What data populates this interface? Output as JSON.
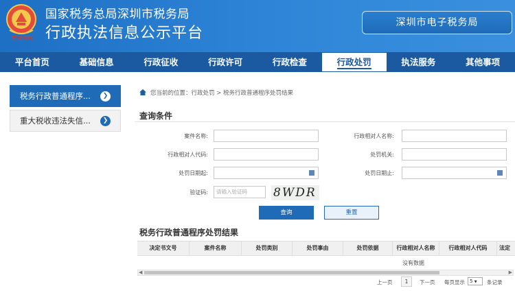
{
  "header": {
    "line1": "国家税务总局深圳市税务局",
    "line2": "行政执法信息公示平台",
    "logo_script": "守法纳税",
    "right_button": "深圳市电子税务局"
  },
  "nav": {
    "items": [
      "平台首页",
      "基础信息",
      "行政征收",
      "行政许可",
      "行政检查",
      "行政处罚",
      "执法服务",
      "其他事项"
    ],
    "active_index": 5
  },
  "sidebar": {
    "items": [
      {
        "label": "税务行政普通程序...",
        "active": true
      },
      {
        "label": "重大税收违法失信...",
        "active": false
      }
    ]
  },
  "breadcrumb": "您当前的位置：行政处罚 > 税务行政普通程序处罚结果",
  "query": {
    "title": "查询条件",
    "fields": {
      "case_name": {
        "label": "案件名称:",
        "value": ""
      },
      "counterpart_name": {
        "label": "行政相对人名称:",
        "value": ""
      },
      "counterpart_code": {
        "label": "行政相对人代码:",
        "value": ""
      },
      "penalty_org": {
        "label": "处罚机关:",
        "value": ""
      },
      "date_start": {
        "label": "处罚日期起:",
        "value": ""
      },
      "date_end": {
        "label": "处罚日期止:",
        "value": ""
      },
      "captcha": {
        "label": "验证码:",
        "placeholder": "请输入验证码"
      }
    },
    "captcha_text": "8WDR",
    "search_button": "查询",
    "reset_button": "重置"
  },
  "results": {
    "title": "税务行政普通程序处罚结果",
    "columns": [
      "决定书文号",
      "案件名称",
      "处罚类别",
      "处罚事由",
      "处罚依据",
      "行政相对人名称",
      "行政相对人代码",
      "法定"
    ],
    "empty_text": "没有数据"
  },
  "pagination": {
    "prev": "上一页",
    "current": "1",
    "next": "下一页",
    "per_page_prefix": "每页显示",
    "per_page_value": "5",
    "per_page_suffix": "条记录"
  },
  "colors": {
    "header_blue": "#2f86d8",
    "nav_blue": "#1b5aa0",
    "accent": "#1f6bb8"
  }
}
